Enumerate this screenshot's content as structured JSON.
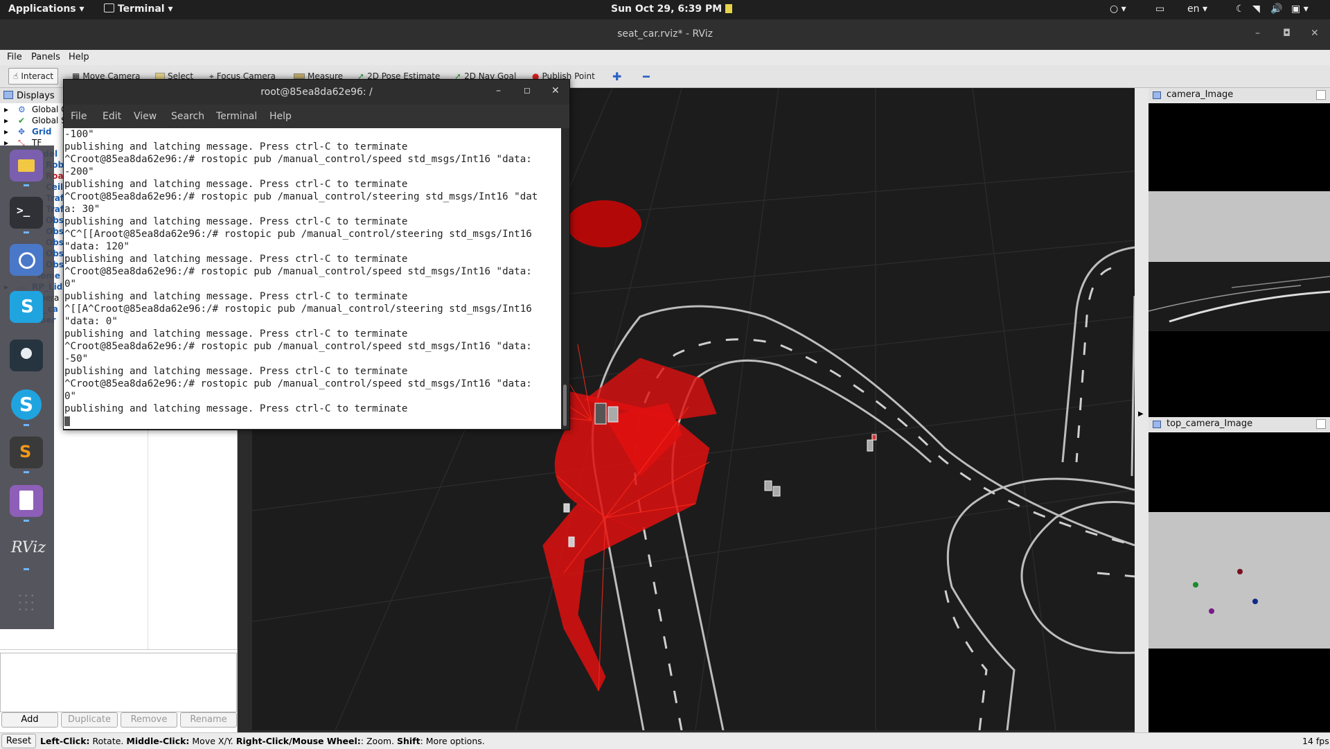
{
  "topbar": {
    "applications": "Applications",
    "terminal_app": "Terminal",
    "clock": "Sun Oct 29,  6:39 PM",
    "language": "en"
  },
  "rviz": {
    "window_title": "seat_car.rviz* - RViz",
    "menu": [
      "File",
      "Panels",
      "Help"
    ],
    "tools": [
      "Interact",
      "Move Camera",
      "Select",
      "Focus Camera",
      "Measure",
      "2D Pose Estimate",
      "2D Nav Goal",
      "Publish Point"
    ],
    "displays_title": "Displays",
    "tree": [
      {
        "label": "Global O",
        "style": "normal"
      },
      {
        "label": "Global S",
        "style": "normal"
      },
      {
        "label": "Grid",
        "style": "blue"
      },
      {
        "label": "TF",
        "style": "normal"
      },
      {
        "label": "odel",
        "style": "blue"
      },
      {
        "label": "Rob",
        "style": "blue"
      },
      {
        "label": "Roa",
        "style": "red"
      },
      {
        "label": "Ceil",
        "style": "blue"
      },
      {
        "label": "Traf",
        "style": "blue"
      },
      {
        "label": "Traf",
        "style": "blue"
      },
      {
        "label": "Obs",
        "style": "blue"
      },
      {
        "label": "Obs",
        "style": "blue"
      },
      {
        "label": "Obs",
        "style": "blue"
      },
      {
        "label": "Obs",
        "style": "blue"
      },
      {
        "label": "Obs",
        "style": "blue"
      },
      {
        "label": "lome",
        "style": "blue"
      },
      {
        "label": "RP_Lid",
        "style": "blue"
      },
      {
        "label": "mera",
        "style": "normal"
      },
      {
        "label": "p_ca",
        "style": "blue"
      },
      {
        "label": "mer",
        "style": "blue"
      }
    ],
    "buttons": {
      "add": "Add",
      "duplicate": "Duplicate",
      "remove": "Remove",
      "rename": "Rename"
    },
    "camera_panel": "camera_Image",
    "top_camera_panel": "top_camera_Image",
    "reset": "Reset",
    "status": {
      "left_click": "Left-Click:",
      "left_click_desc": " Rotate. ",
      "middle_click": "Middle-Click:",
      "middle_click_desc": " Move X/Y. ",
      "right_click": "Right-Click/Mouse Wheel:",
      "right_click_desc": ": Zoom. ",
      "shift": "Shift",
      "shift_desc": ": More options."
    },
    "fps": "14 fps"
  },
  "terminal": {
    "title": "root@85ea8da62e96: /",
    "menu": [
      "File",
      "Edit",
      "View",
      "Search",
      "Terminal",
      "Help"
    ],
    "lines": [
      "-100\"",
      "publishing and latching message. Press ctrl-C to terminate",
      "^Croot@85ea8da62e96:/# rostopic pub /manual_control/speed std_msgs/Int16 \"data:",
      "-200\"",
      "publishing and latching message. Press ctrl-C to terminate",
      "^Croot@85ea8da62e96:/# rostopic pub /manual_control/steering std_msgs/Int16 \"dat",
      "a: 30\"",
      "publishing and latching message. Press ctrl-C to terminate",
      "^C^[[Aroot@85ea8da62e96:/# rostopic pub /manual_control/steering std_msgs/Int16",
      "\"data: 120\"",
      "publishing and latching message. Press ctrl-C to terminate",
      "^Croot@85ea8da62e96:/# rostopic pub /manual_control/speed std_msgs/Int16 \"data:",
      "0\"",
      "publishing and latching message. Press ctrl-C to terminate",
      "^[[A^Croot@85ea8da62e96:/# rostopic pub /manual_control/steering std_msgs/Int16",
      "\"data: 0\"",
      "publishing and latching message. Press ctrl-C to terminate",
      "^Croot@85ea8da62e96:/# rostopic pub /manual_control/speed std_msgs/Int16 \"data:",
      "-50\"",
      "publishing and latching message. Press ctrl-C to terminate",
      "^Croot@85ea8da62e96:/# rostopic pub /manual_control/speed std_msgs/Int16 \"data:",
      "0\"",
      "publishing and latching message. Press ctrl-C to terminate"
    ]
  },
  "dock_icons": [
    "files-icon",
    "terminal-icon",
    "chromium-icon",
    "skype-icon",
    "pin-icon",
    "skype-preview-icon",
    "sublime-icon",
    "text-editor-icon",
    "rviz-icon",
    "app-grid-icon"
  ],
  "colors": {
    "laser": "#e01010",
    "accent": "#1a5fb4",
    "dock": "#464650"
  }
}
